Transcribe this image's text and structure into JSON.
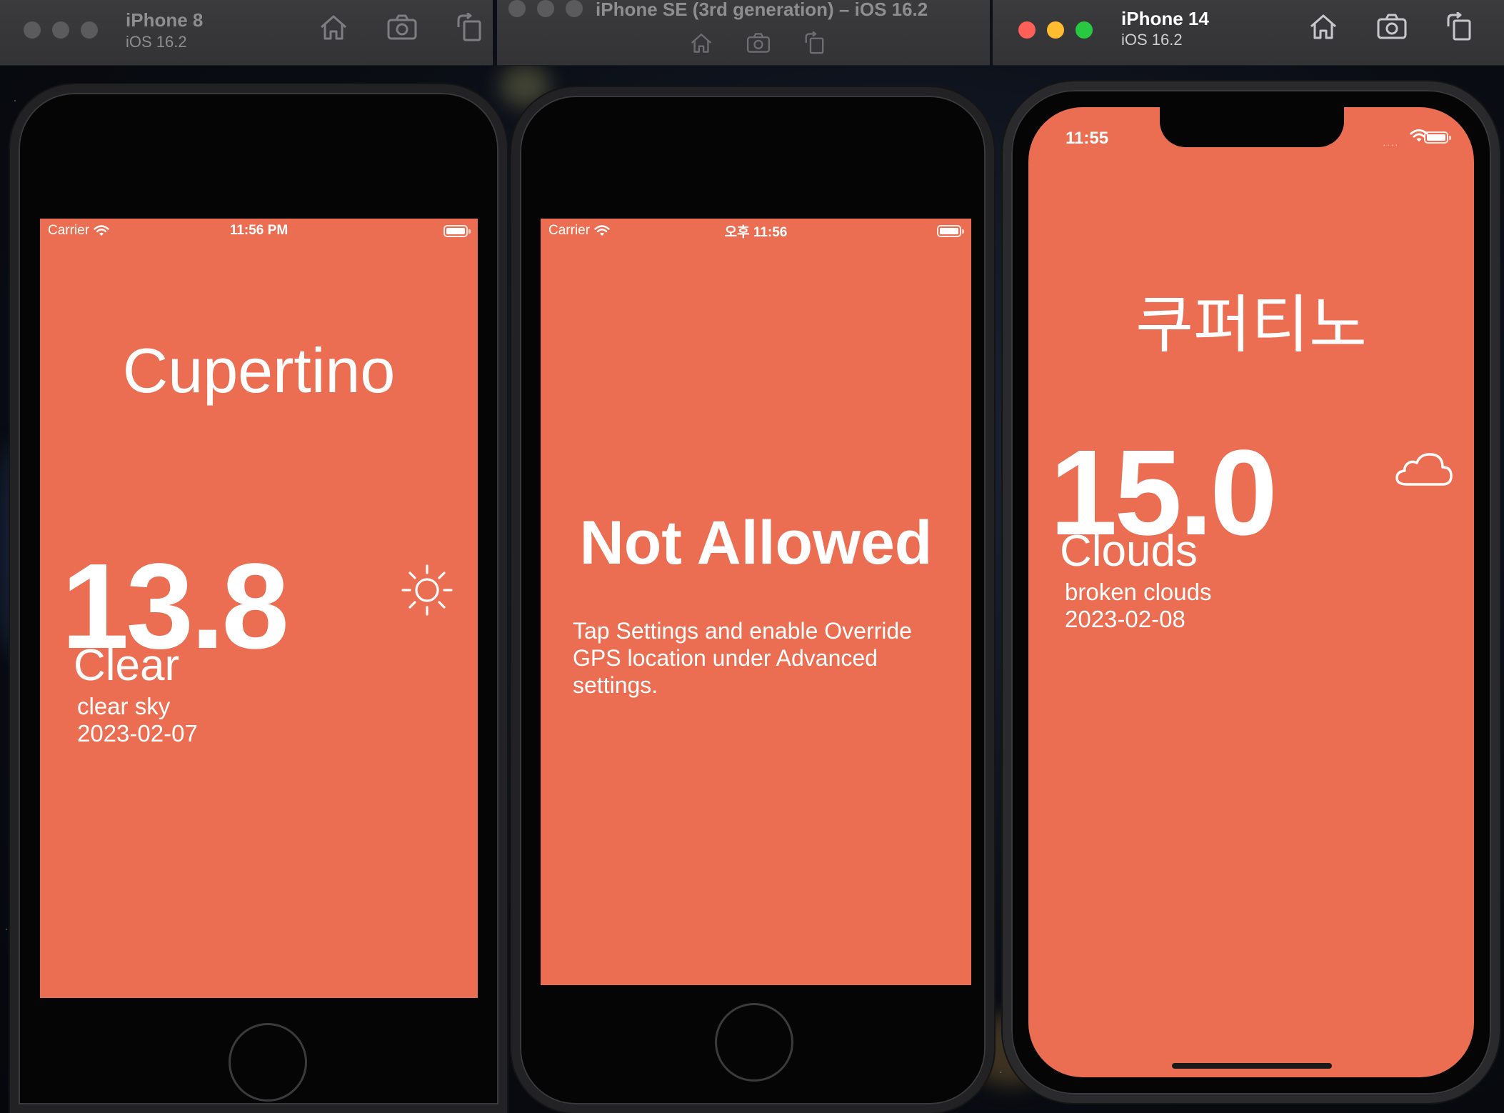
{
  "simulators": [
    {
      "window_title": "iPhone 8",
      "os_version": "iOS 16.2",
      "screen": {
        "status": {
          "carrier": "Carrier",
          "time": "11:56 PM"
        },
        "city": "Cupertino",
        "temperature": "13.8",
        "weather_main": "Clear",
        "weather_description": "clear sky",
        "date": "2023-02-07",
        "weather_icon": "sun-icon"
      }
    },
    {
      "window_title": "iPhone SE (3rd generation) – iOS 16.2",
      "screen": {
        "status": {
          "carrier": "Carrier",
          "time": "오후 11:56"
        },
        "heading": "Not Allowed",
        "message": "Tap Settings and enable Override GPS location under Advanced settings."
      }
    },
    {
      "window_title": "iPhone 14",
      "os_version": "iOS 16.2",
      "screen": {
        "status": {
          "time": "11:55"
        },
        "city": "쿠퍼티노",
        "temperature": "15.0",
        "weather_main": "Clouds",
        "weather_description": "broken clouds",
        "date": "2023-02-08",
        "weather_icon": "cloud-icon"
      }
    }
  ],
  "toolbar_icons": [
    "home-icon",
    "screenshot-icon",
    "rotate-icon"
  ],
  "colors": {
    "screen_background": "#eb6e52",
    "text": "#ffffff",
    "titlebar": "#363638",
    "traffic_red": "#fe5f57",
    "traffic_yellow": "#febc2e",
    "traffic_green": "#28c840"
  }
}
